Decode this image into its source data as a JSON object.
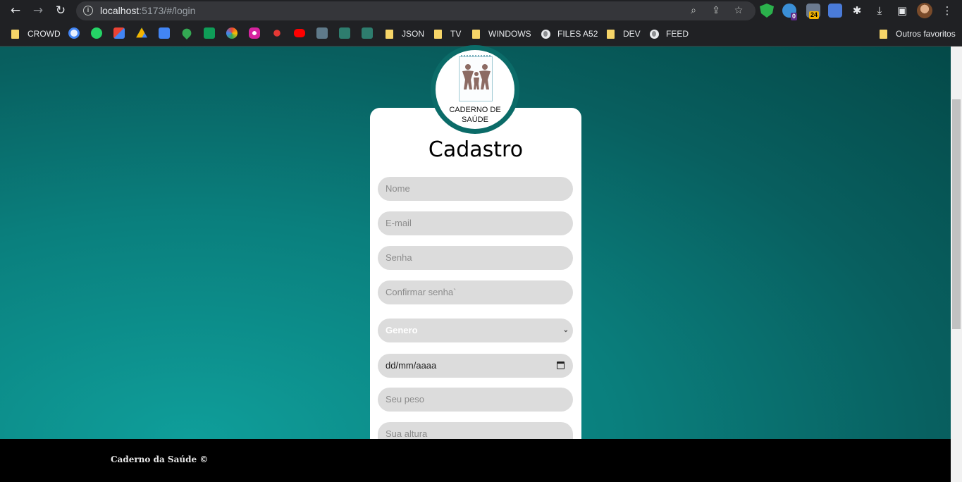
{
  "browser": {
    "url_host": "localhost",
    "url_rest": ":5173/#/login"
  },
  "extensions": {
    "badge_1": "0",
    "badge_2": "24"
  },
  "bookmarks": {
    "items": [
      "CROWD",
      "JSON",
      "TV",
      "WINDOWS",
      "FILES A52",
      "DEV",
      "FEED"
    ],
    "other": "Outros favoritos"
  },
  "logo": {
    "line1": "CADERNO DE",
    "line2": "SAÚDE"
  },
  "form": {
    "title": "Cadastro",
    "name_placeholder": "Nome",
    "email_placeholder": "E-mail",
    "password_placeholder": "Senha",
    "confirm_placeholder": "Confirmar senha`",
    "gender_selected": "Genero",
    "date_value": "dd/mm/aaaa",
    "weight_placeholder": "Seu peso",
    "height_placeholder": "Sua altura"
  },
  "footer": {
    "text": "Caderno da Saúde ©"
  },
  "colors": {
    "accent": "#0b6b68",
    "field_bg": "#dcdcdc",
    "footer_bg": "#000000"
  }
}
